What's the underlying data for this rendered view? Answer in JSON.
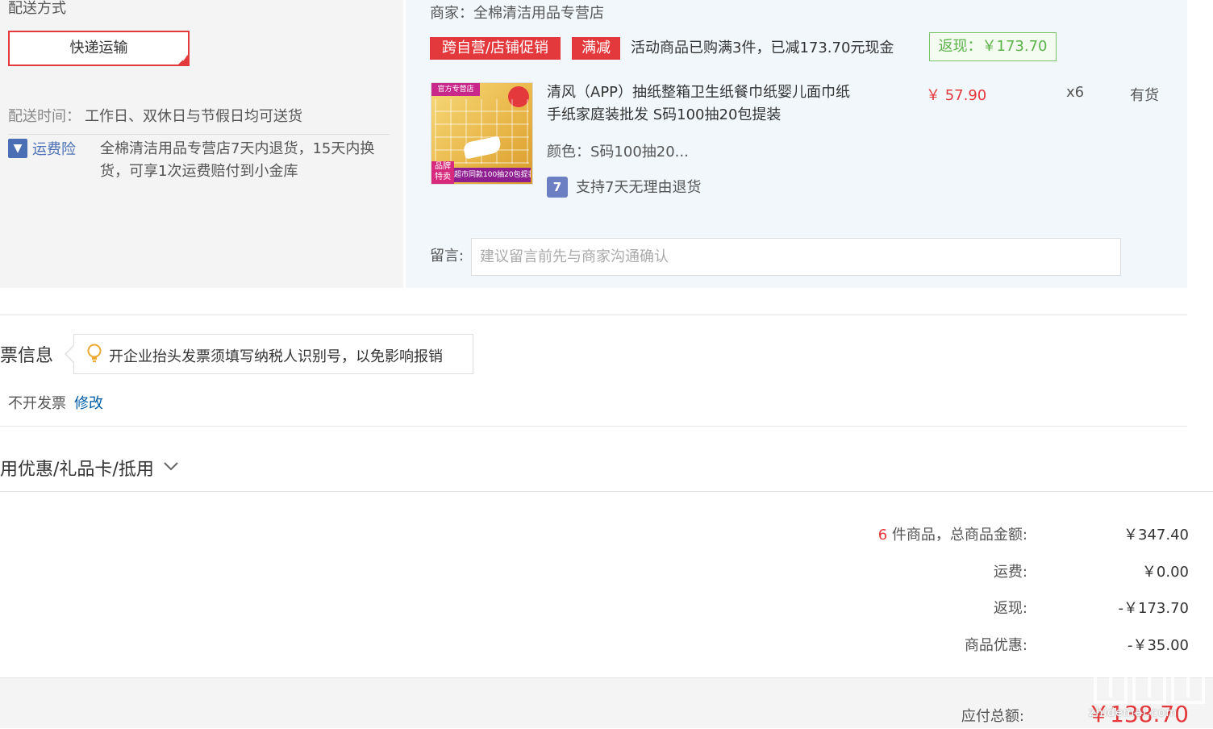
{
  "shipping": {
    "title": "配送方式",
    "express_label": "快递运输",
    "time_label": "配送时间：",
    "time_value": "工作日、双休日与节假日均可送货",
    "insurance_label": "运费险",
    "insurance_desc": "全棉清洁用品专营店7天内退货，15天内换货，可享1次运费赔付到小金库"
  },
  "merchant": {
    "line": "商家：全棉清洁用品专营店",
    "tag_promo": "跨自营/店铺促销",
    "tag_discount": "满减",
    "promo_text": "活动商品已购满3件，已减173.70元现金",
    "rebate": "返现：￥173.70"
  },
  "product": {
    "name": "清风（APP）抽纸整箱卫生纸餐巾纸婴儿面巾纸手纸家庭装批发 S码100抽20包提装",
    "price": "￥ 57.90",
    "quantity": "x6",
    "stock": "有货",
    "color": "颜色：S码100抽20...",
    "return_policy": "支持7天无理由退货",
    "image_badge_top": "官方专营店",
    "image_brand_tag": "品牌特卖",
    "image_bottom_text": "超市同款100抽20包提装"
  },
  "message": {
    "label": "留言:",
    "placeholder": "建议留言前先与商家沟通确认",
    "value": ""
  },
  "invoice": {
    "title": "票信息",
    "tip": "开企业抬头发票须填写纳税人识别号，以免影响报销",
    "value": "不开发票",
    "modify": "修改"
  },
  "coupon": {
    "title": "用优惠/礼品卡/抵用"
  },
  "summary": {
    "count": "6",
    "count_label": " 件商品，总商品金额:",
    "total_goods": "￥347.40",
    "shipping_label": "运费:",
    "shipping_value": "￥0.00",
    "rebate_label": "返现:",
    "rebate_value": "-￥173.70",
    "discount_label": "商品优惠:",
    "discount_value": "-￥35.00",
    "payable_label": "应付总额:",
    "payable_value": "￥138.70"
  },
  "watermark": {
    "text": "zhidemai.com"
  },
  "colors": {
    "accent_red": "#e4393c",
    "link_blue": "#005ea7",
    "rebate_green": "#5bb34a"
  }
}
